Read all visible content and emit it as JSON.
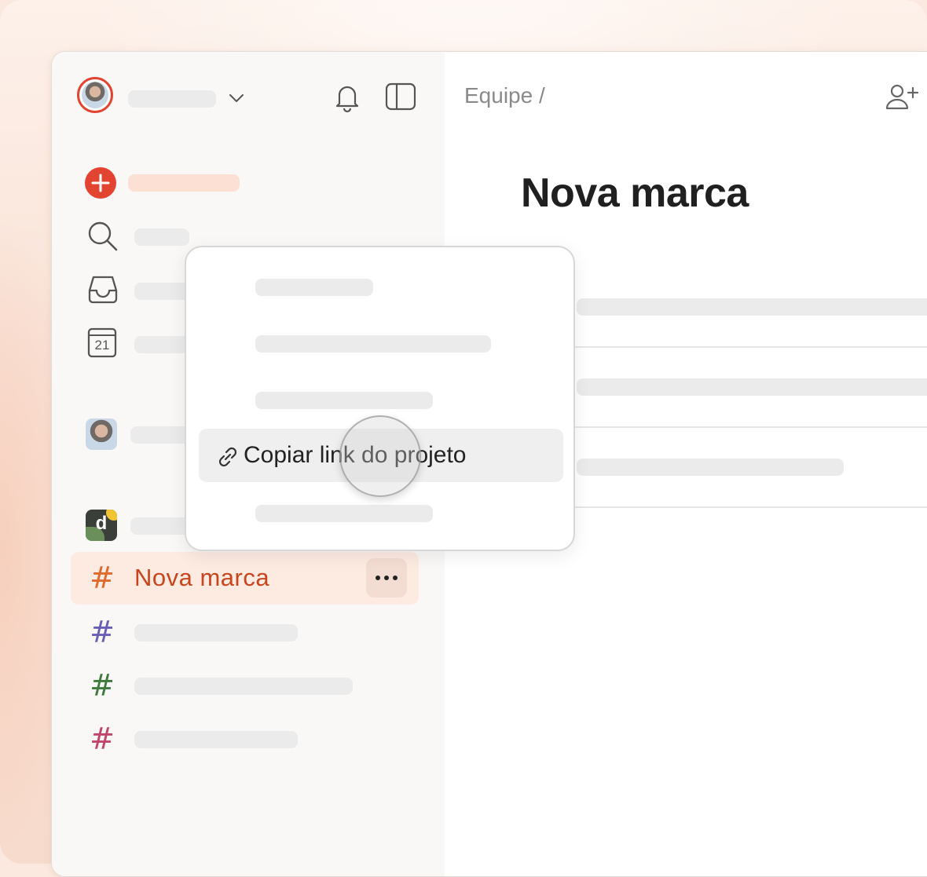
{
  "header": {
    "notifications_icon": "bell-icon",
    "layout_icon": "sidebar-toggle-icon"
  },
  "breadcrumb": "Equipe /",
  "page_title": "Nova marca",
  "sidebar": {
    "nav_icons": [
      "add-task-icon",
      "search-icon",
      "inbox-icon",
      "calendar-icon"
    ],
    "calendar_day": "21",
    "team_badge": "d",
    "active_project": {
      "label": "Nova marca",
      "color": "#c8451d"
    },
    "project_colors": [
      "#e06a2b",
      "#6a5fb8",
      "#3f7a3d",
      "#c2466c"
    ]
  },
  "context_menu": {
    "highlighted_item": "Copiar link do projeto",
    "item_icon": "link-icon"
  },
  "colors": {
    "accent": "#e34432",
    "active_row_bg": "#fdebe2"
  }
}
